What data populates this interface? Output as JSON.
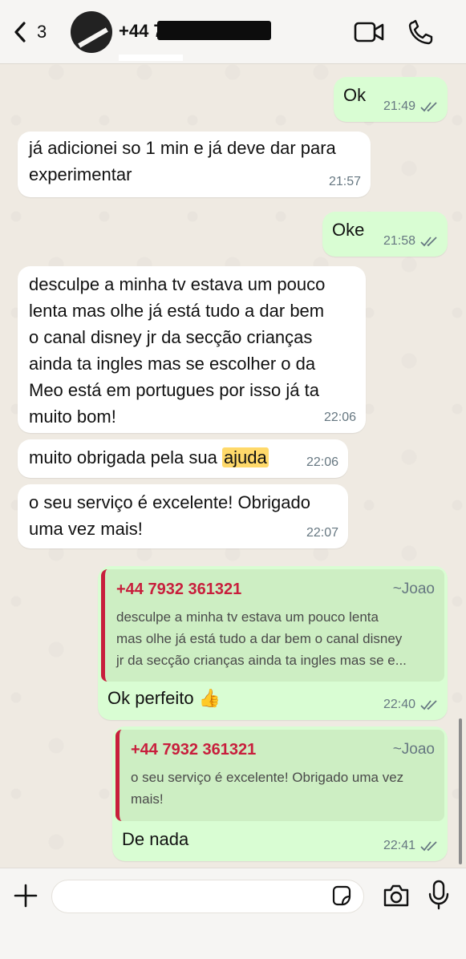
{
  "header": {
    "back_count": "3",
    "contact_name": "+44 7",
    "icons": [
      "chevron-left-icon",
      "video-call-icon",
      "phone-icon"
    ]
  },
  "messages": [
    {
      "direction": "out",
      "text": "Ok",
      "time": "21:49",
      "status": "read"
    },
    {
      "direction": "in",
      "text": "já adicionei so 1 min e já deve dar para\nexperimentar",
      "time": "21:57"
    },
    {
      "direction": "out",
      "text": "Oke",
      "time": "21:58",
      "status": "read"
    },
    {
      "direction": "in",
      "text": "desculpe a minha tv estava um pouco\nlenta mas olhe já está tudo a dar bem\no canal disney jr da secção crianças\nainda ta ingles mas se escolher o da\nMeo está em portugues por isso já ta\nmuito bom!",
      "time": "22:06"
    },
    {
      "direction": "in",
      "text_before": "muito obrigada pela sua ",
      "highlight": "ajuda",
      "time": "22:06"
    },
    {
      "direction": "in",
      "text": "o seu serviço é excelente! Obrigado\numa vez mais!",
      "time": "22:07"
    },
    {
      "direction": "out",
      "quote": {
        "sender": "+44 7932 361321",
        "alias": "~Joao",
        "text": "desculpe a minha tv estava um pouco lenta\nmas olhe já está tudo a dar bem o canal disney\njr da secção crianças ainda ta ingles mas se e..."
      },
      "text": "Ok perfeito 👍",
      "time": "22:40",
      "status": "read"
    },
    {
      "direction": "out",
      "quote": {
        "sender": "+44 7932 361321",
        "alias": "~Joao",
        "text": "o seu serviço é excelente! Obrigado uma vez\nmais!"
      },
      "text": "De nada",
      "time": "22:41",
      "status": "read"
    }
  ],
  "input": {
    "placeholder": "",
    "icons": [
      "plus-icon",
      "sticker-icon",
      "camera-icon",
      "microphone-icon"
    ]
  },
  "colors": {
    "chat_background": "#efeae2",
    "incoming_bubble": "#ffffff",
    "outgoing_bubble": "#d9fdd3",
    "quote_accent": "#c81e3c",
    "highlight": "#ffd96a"
  }
}
